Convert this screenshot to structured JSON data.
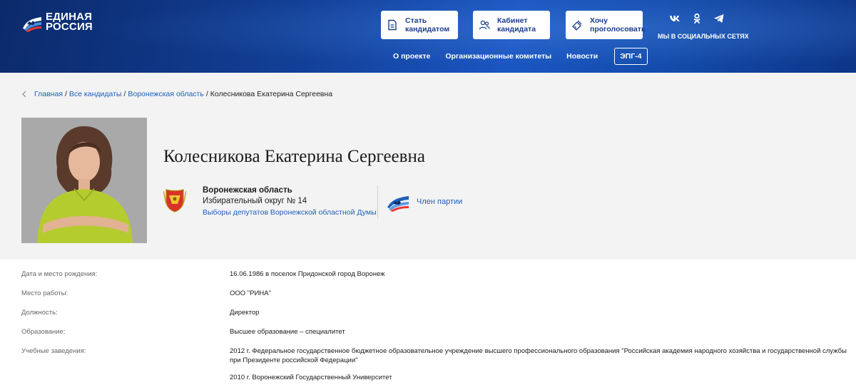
{
  "header": {
    "logo_line1": "ЕДИНАЯ",
    "logo_line2": "РОССИЯ",
    "buttons": [
      {
        "line1": "Стать",
        "line2": "кандидатом",
        "icon": "document-icon"
      },
      {
        "line1": "Кабинет",
        "line2": "кандидата",
        "icon": "users-icon"
      },
      {
        "line1": "Хочу",
        "line2": "проголосовать",
        "icon": "ballot-icon"
      }
    ],
    "social_label": "МЫ В СОЦИАЛЬНЫХ СЕТЯХ",
    "nav": [
      "О проекте",
      "Организационные комитеты",
      "Новости"
    ],
    "epg_label": "ЭПГ-4"
  },
  "breadcrumb": {
    "home": "Главная",
    "all": "Все кандидаты",
    "region": "Воронежская область",
    "current": "Колесникова Екатерина Сергеевна",
    "sep": "/"
  },
  "candidate": {
    "name": "Колесникова Екатерина Сергеевна",
    "region": "Воронежская область",
    "district": "Избирательный округ № 14",
    "election": "Выборы депутатов Воронежской областной Думы",
    "status": "Член партии"
  },
  "info": [
    {
      "label": "Дата и место рождения:",
      "value": "16.06.1986 в поселок Придонской город Воронеж"
    },
    {
      "label": "Место работы:",
      "value": "ООО \"РИНА\""
    },
    {
      "label": "Должность:",
      "value": "Директор"
    },
    {
      "label": "Образование:",
      "value": "Высшее образование – специалитет"
    },
    {
      "label": "Учебные заведения:",
      "value": "2012 г. Федеральное государственное бюджетное образовательное учреждение высшего профессионального образования \"Российская академия народного хозяйства и государственной службы при Президенте российской Федерации\""
    },
    {
      "label": "",
      "value": "2010 г. Воронежский Государственный Университет"
    }
  ],
  "colors": {
    "header_bg": "#123f96",
    "link": "#1f5fb8",
    "button_text": "#1a3d8f",
    "main_bg": "#f3f3f3"
  }
}
